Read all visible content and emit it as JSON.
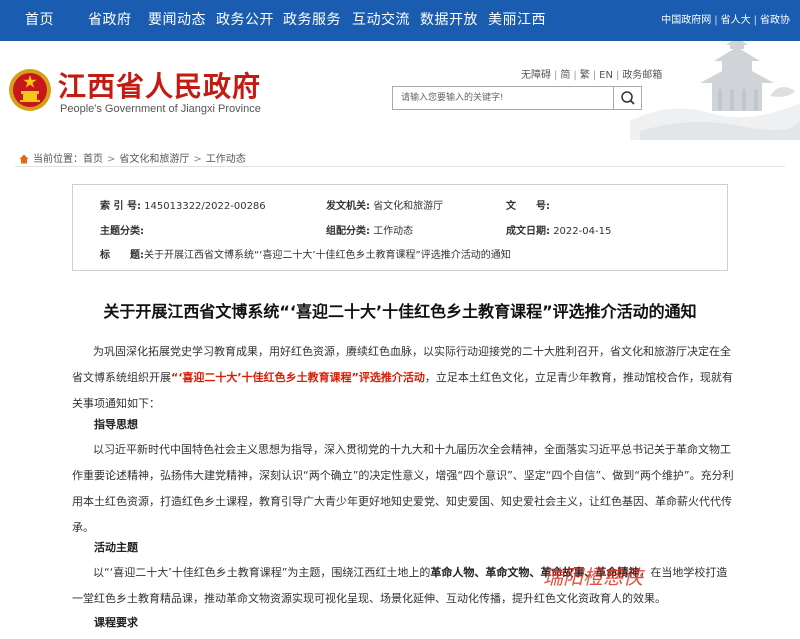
{
  "topnav": {
    "items": [
      "首页",
      "省政府",
      "要闻动态",
      "政务公开",
      "政务服务",
      "互动交流",
      "数据开放",
      "美丽江西"
    ],
    "links": [
      "中国政府网",
      "省人大",
      "省政协"
    ]
  },
  "header": {
    "title": "江西省人民政府",
    "subtitle": "People's Government of Jiangxi Province",
    "util": [
      "无障碍",
      "简",
      "繁",
      "EN",
      "政务邮箱"
    ],
    "search_placeholder": "请输入您要输入的关键字!"
  },
  "breadcrumb": {
    "label": "当前位置：",
    "items": [
      "首页",
      "省文化和旅游厅",
      "工作动态"
    ]
  },
  "info": {
    "index_label": "索 引 号:",
    "index_value": "145013322/2022-00286",
    "issuer_label": "发文机关:",
    "issuer_value": "省文化和旅游厅",
    "docno_label": "文　　号:",
    "docno_value": "",
    "topic_label": "主题分类:",
    "topic_value": "",
    "category_label": "组配分类:",
    "category_value": "工作动态",
    "date_label": "成文日期:",
    "date_value": "2022-04-15",
    "title_label": "标　　题:",
    "title_value": "关于开展江西省文博系统“‘喜迎二十大’十佳红色乡土教育课程”评选推介活动的通知"
  },
  "article": {
    "title": "关于开展江西省文博系统“‘喜迎二十大’十佳红色乡土教育课程”评选推介活动的通知",
    "p1_a": "为巩固深化拓展党史学习教育成果，用好红色资源，赓续红色血脉，以实际行动迎接党的二十大胜利召开，省文化和旅游厅决定在全省文博系统组织开展",
    "p1_red": "“‘喜迎二十大’十佳红色乡土教育课程”评选推介活动",
    "p1_b": "，立足本土红色文化，立足青少年教育，推动馆校合作，现就有关事项通知如下：",
    "h1": "指导思想",
    "p2": "以习近平新时代中国特色社会主义思想为指导，深入贯彻党的十九大和十九届历次全会精神，全面落实习近平总书记关于革命文物工作重要论述精神，弘扬伟大建党精神，深刻认识“两个确立”的决定性意义，增强“四个意识”、坚定“四个自信”、做到“两个维护”。充分利用本土红色资源，打造红色乡土课程，教育引导广大青少年更好地知史爱党、知史爱国、知史爱社会主义，让红色基因、革命薪火代代传承。",
    "h2": "活动主题",
    "p3_a": "以“‘喜迎二十大’十佳红色乡土教育课程”为主题，围绕江西红土地上的",
    "p3_b1": "革命人物、革命文物、革命故事、革命精神",
    "p3_c": "，在当地学校打造一堂红色乡土教育精品课，推动革命文物资源实现可视化呈现、场景化延伸、互动化传播，提升红色文化资政育人的效果。",
    "h3": "课程要求",
    "watermark": "瑞阳橙慈侠"
  },
  "colors": {
    "nav_blue": "#1a5cb0",
    "title_red": "#c41a12",
    "highlight_red": "#d81e06"
  }
}
